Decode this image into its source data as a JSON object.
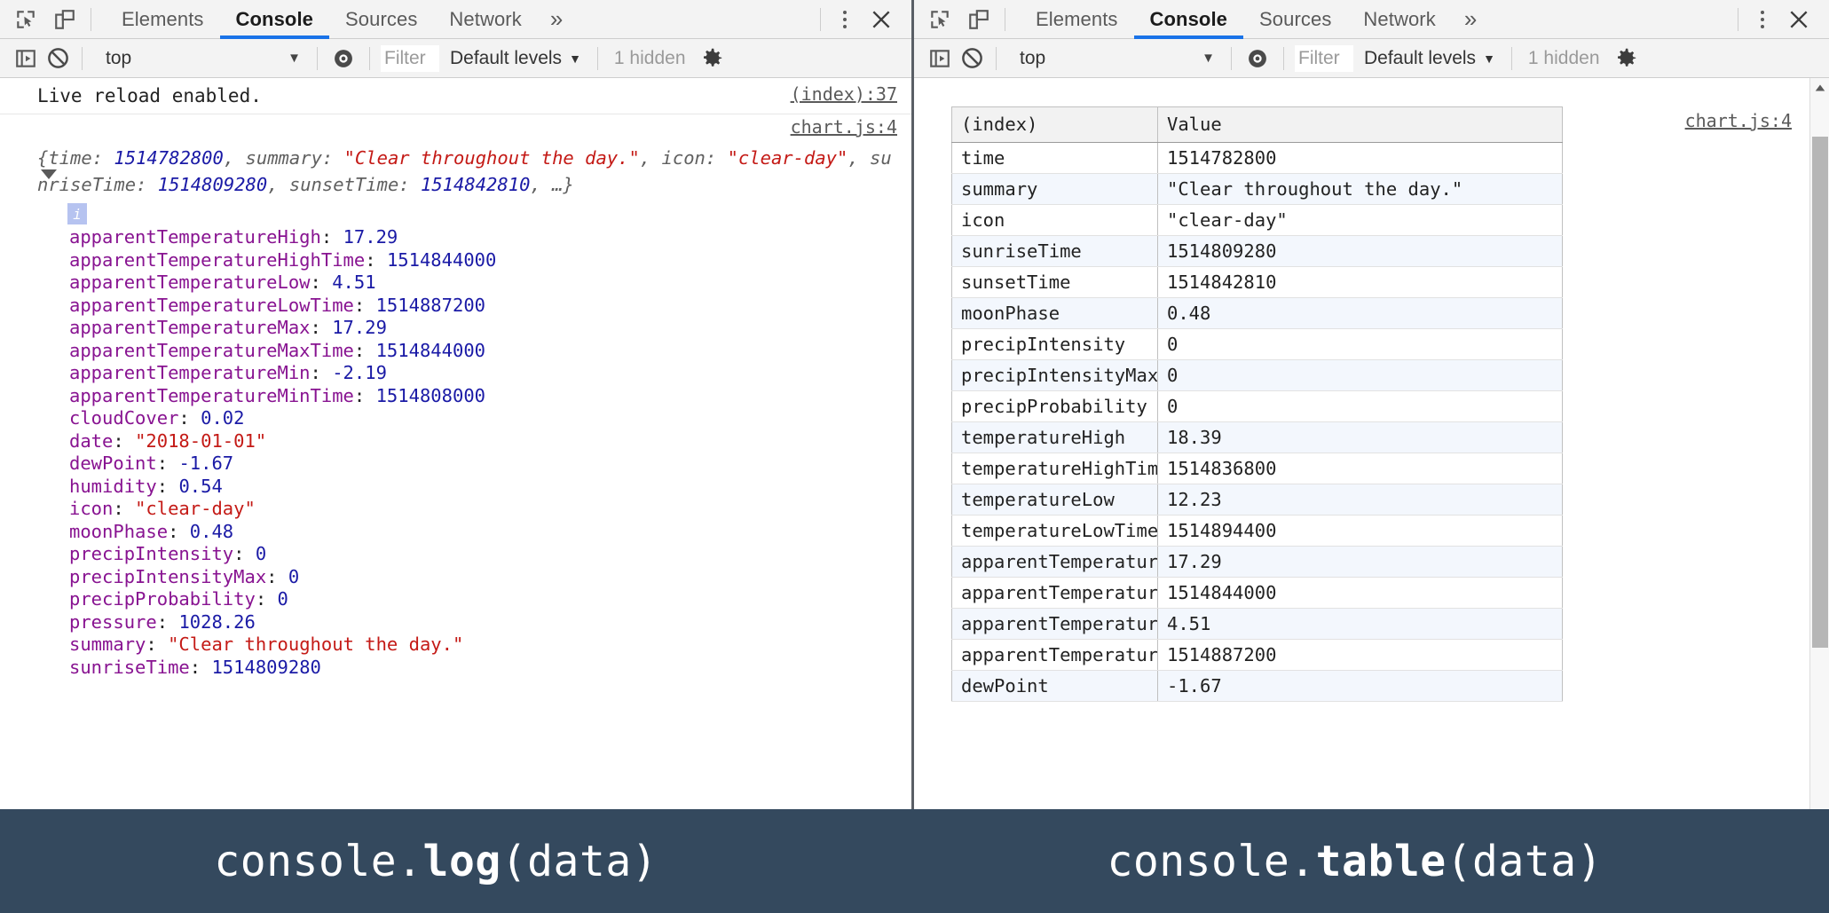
{
  "devtools": {
    "icons": {
      "inspect": "inspect-element-icon",
      "device": "device-toolbar-icon",
      "sidebar": "console-sidebar-icon",
      "clear": "clear-console-icon",
      "eye": "live-expression-icon",
      "gear": "settings-gear-icon",
      "close": "close-icon",
      "more_tabs": "»",
      "caret": "▼",
      "x": "✕"
    },
    "tabs": [
      {
        "label": "Elements",
        "active": false
      },
      {
        "label": "Console",
        "active": true
      },
      {
        "label": "Sources",
        "active": false
      },
      {
        "label": "Network",
        "active": false
      }
    ],
    "filterbar": {
      "context": "top",
      "filter_placeholder": "Filter",
      "levels": "Default levels",
      "hidden": "1 hidden"
    }
  },
  "left_panel": {
    "messages": {
      "live_reload": "Live reload enabled.",
      "live_reload_source": "(index):37"
    },
    "object": {
      "source": "chart.js:4",
      "preview_parts": [
        {
          "text": "{time: ",
          "type": "plain"
        },
        {
          "text": "1514782800",
          "type": "num"
        },
        {
          "text": ", summary: ",
          "type": "plain"
        },
        {
          "text": "\"Clear throughout the day.\"",
          "type": "str"
        },
        {
          "text": ", icon: ",
          "type": "plain"
        },
        {
          "text": "\"clear-day\"",
          "type": "str"
        },
        {
          "text": ", sunriseTime: ",
          "type": "plain"
        },
        {
          "text": "1514809280",
          "type": "num"
        },
        {
          "text": ", sunsetTime: ",
          "type": "plain"
        },
        {
          "text": "1514842810",
          "type": "num"
        },
        {
          "text": ", …}",
          "type": "plain"
        }
      ],
      "info_badge": "i",
      "properties": [
        {
          "key": "apparentTemperatureHigh",
          "value": "17.29",
          "type": "num"
        },
        {
          "key": "apparentTemperatureHighTime",
          "value": "1514844000",
          "type": "num"
        },
        {
          "key": "apparentTemperatureLow",
          "value": "4.51",
          "type": "num"
        },
        {
          "key": "apparentTemperatureLowTime",
          "value": "1514887200",
          "type": "num"
        },
        {
          "key": "apparentTemperatureMax",
          "value": "17.29",
          "type": "num"
        },
        {
          "key": "apparentTemperatureMaxTime",
          "value": "1514844000",
          "type": "num"
        },
        {
          "key": "apparentTemperatureMin",
          "value": "-2.19",
          "type": "num"
        },
        {
          "key": "apparentTemperatureMinTime",
          "value": "1514808000",
          "type": "num"
        },
        {
          "key": "cloudCover",
          "value": "0.02",
          "type": "num"
        },
        {
          "key": "date",
          "value": "\"2018-01-01\"",
          "type": "str"
        },
        {
          "key": "dewPoint",
          "value": "-1.67",
          "type": "num"
        },
        {
          "key": "humidity",
          "value": "0.54",
          "type": "num"
        },
        {
          "key": "icon",
          "value": "\"clear-day\"",
          "type": "str"
        },
        {
          "key": "moonPhase",
          "value": "0.48",
          "type": "num"
        },
        {
          "key": "precipIntensity",
          "value": "0",
          "type": "num"
        },
        {
          "key": "precipIntensityMax",
          "value": "0",
          "type": "num"
        },
        {
          "key": "precipProbability",
          "value": "0",
          "type": "num"
        },
        {
          "key": "pressure",
          "value": "1028.26",
          "type": "num"
        },
        {
          "key": "summary",
          "value": "\"Clear throughout the day.\"",
          "type": "str"
        },
        {
          "key": "sunriseTime",
          "value": "1514809280",
          "type": "num"
        }
      ]
    }
  },
  "right_panel": {
    "source": "chart.js:4",
    "table": {
      "columns": [
        "(index)",
        "Value"
      ],
      "rows": [
        {
          "index": "time",
          "value": "1514782800",
          "type": "num"
        },
        {
          "index": "summary",
          "value": "\"Clear throughout the day.\"",
          "type": "str"
        },
        {
          "index": "icon",
          "value": "\"clear-day\"",
          "type": "str"
        },
        {
          "index": "sunriseTime",
          "value": "1514809280",
          "type": "num"
        },
        {
          "index": "sunsetTime",
          "value": "1514842810",
          "type": "num"
        },
        {
          "index": "moonPhase",
          "value": "0.48",
          "type": "num"
        },
        {
          "index": "precipIntensity",
          "value": "0",
          "type": "num"
        },
        {
          "index": "precipIntensityMax",
          "value": "0",
          "type": "num"
        },
        {
          "index": "precipProbability",
          "value": "0",
          "type": "num"
        },
        {
          "index": "temperatureHigh",
          "value": "18.39",
          "type": "num"
        },
        {
          "index": "temperatureHighTime",
          "value": "1514836800",
          "type": "num"
        },
        {
          "index": "temperatureLow",
          "value": "12.23",
          "type": "num"
        },
        {
          "index": "temperatureLowTime",
          "value": "1514894400",
          "type": "num"
        },
        {
          "index": "apparentTemperatureHigh",
          "value": "17.29",
          "type": "num"
        },
        {
          "index": "apparentTemperatureHighTime",
          "value": "1514844000",
          "type": "num"
        },
        {
          "index": "apparentTemperatureLow",
          "value": "4.51",
          "type": "num"
        },
        {
          "index": "apparentTemperatureLowTime",
          "value": "1514887200",
          "type": "num"
        },
        {
          "index": "dewPoint",
          "value": "-1.67",
          "type": "num"
        }
      ]
    }
  },
  "captions": {
    "left": {
      "pre": "console.",
      "bold": "log",
      "post": "(data)"
    },
    "right": {
      "pre": "console.",
      "bold": "table",
      "post": "(data)"
    }
  },
  "colors": {
    "accent": "#1a73e8",
    "caption_bg": "#34495e",
    "key": "#881391",
    "number": "#1a1aa6",
    "string": "#c41a16",
    "row_stripe": "#f3f7fd"
  }
}
